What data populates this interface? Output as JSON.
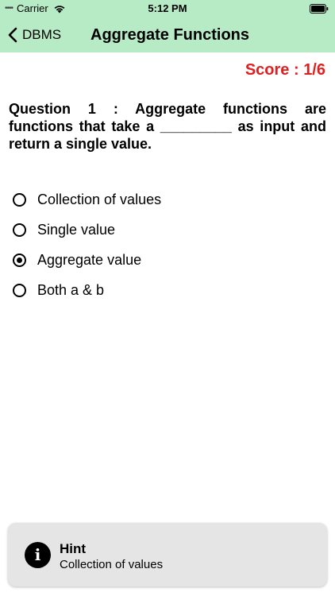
{
  "status_bar": {
    "signal": "••••",
    "carrier": "Carrier",
    "time": "5:12 PM",
    "wifi_icon": "wifi-icon",
    "battery_icon": "battery-icon"
  },
  "nav": {
    "back_label": "DBMS",
    "back_icon": "chevron-left-icon",
    "title": "Aggregate Functions",
    "background_color": "#b6ebc6"
  },
  "score": {
    "text": "Score : 1/6",
    "color": "#e02020"
  },
  "question": {
    "text": "Question 1 : Aggregate functions are functions that take a _________ as input and return a single value."
  },
  "options": [
    {
      "label": "Collection of values",
      "selected": false
    },
    {
      "label": "Single value",
      "selected": false
    },
    {
      "label": "Aggregate value",
      "selected": true
    },
    {
      "label": "Both a & b",
      "selected": false
    }
  ],
  "hint": {
    "icon": "info-icon",
    "title": "Hint",
    "text": "Collection of values"
  }
}
